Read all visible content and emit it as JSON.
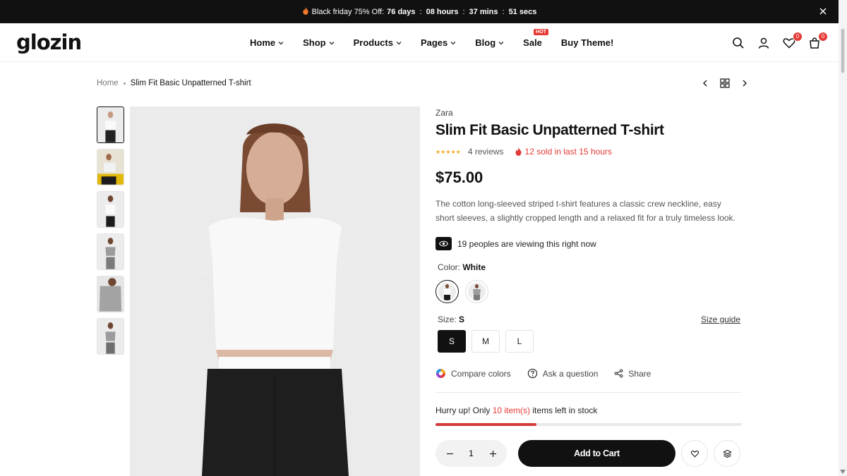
{
  "announcement": {
    "label": "Black friday 75% Off:",
    "days": "76 days",
    "hours": "08 hours",
    "mins": "37 mins",
    "secs": "51 secs",
    "separator": ":"
  },
  "header": {
    "logo": "glozin",
    "nav": [
      {
        "label": "Home"
      },
      {
        "label": "Shop"
      },
      {
        "label": "Products"
      },
      {
        "label": "Pages"
      },
      {
        "label": "Blog"
      },
      {
        "label": "Sale",
        "badge": "HOT"
      },
      {
        "label": "Buy Theme!"
      }
    ],
    "wishlist_count": "0",
    "cart_count": "0"
  },
  "breadcrumb": {
    "home": "Home",
    "current": "Slim Fit Basic Unpatterned T-shirt"
  },
  "product": {
    "brand": "Zara",
    "title": "Slim Fit Basic Unpatterned T-shirt",
    "stars": "★★★★★",
    "reviews": "4 reviews",
    "sold": "12 sold in last 15 hours",
    "price": "$75.00",
    "description": "The cotton long-sleeved striped t-shirt features a classic crew neckline, easy short sleeves, a slightly cropped length and a relaxed fit for a truly timeless look.",
    "viewers": "19 peoples are viewing this right now",
    "color_label": "Color:",
    "color_value": "White",
    "size_label": "Size:",
    "size_value": "S",
    "size_guide": "Size guide",
    "sizes": [
      "S",
      "M",
      "L"
    ],
    "actions": {
      "compare": "Compare colors",
      "ask": "Ask a question",
      "share": "Share"
    },
    "stock": {
      "prefix": "Hurry up! Only",
      "count": "10 item(s)",
      "suffix": "items left in stock",
      "level": 0.33
    },
    "quantity": "1",
    "add_to_cart": "Add to Cart"
  },
  "colors": {
    "accent": "#e53935",
    "dark": "#111111",
    "star": "#f5a623"
  }
}
